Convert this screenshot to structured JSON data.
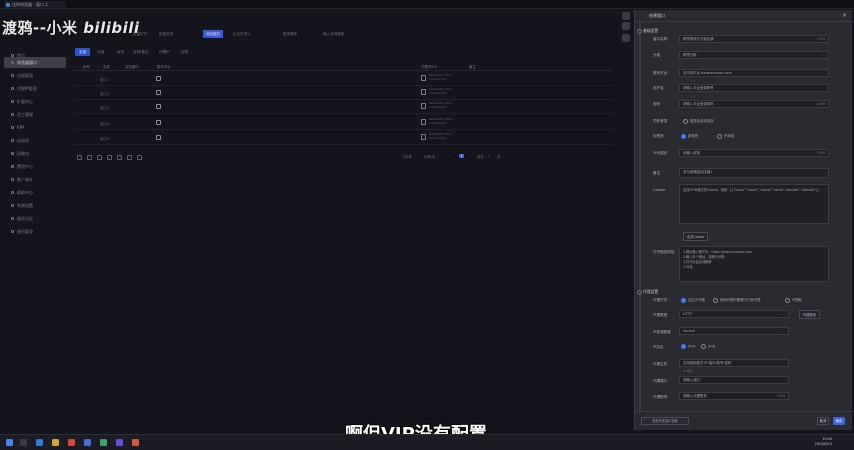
{
  "window": {
    "tab_title": "比特浏览器 - 窗口 1"
  },
  "watermark": {
    "text": "渡鸦--小米",
    "logo": "bilibili"
  },
  "toolbar": {
    "buttons": [
      "批量打开",
      "批量关闭",
      "添加窗口",
      "从文件导入",
      "更多操作",
      "输入名称搜索"
    ]
  },
  "filters": [
    "全部",
    "分组",
    "序号",
    "名称/备注",
    "代理IP",
    "标签"
  ],
  "table": {
    "headers": [
      "序号",
      "名称",
      "浏览器ID",
      "账号平台",
      "代理IP/UA",
      "备注"
    ],
    "rows": [
      {
        "name": "窗口1",
        "ua": "Mozilla/5.0 (Win...",
        "ua2": "Chrome/112"
      },
      {
        "name": "窗口2",
        "ua": "Mozilla/5.0 (Win...",
        "ua2": "Chrome/112"
      },
      {
        "name": "窗口3",
        "ua": "Mozilla/5.0 (Win...",
        "ua2": "Chrome/112"
      },
      {
        "name": "窗口4",
        "ua": "Mozilla/5.0 (Win...",
        "ua2": "Chrome/112"
      },
      {
        "name": "窗口5",
        "ua": "Mozilla/5.0 (Win...",
        "ua2": "Chrome/112"
      }
    ],
    "pager": {
      "total": "共5条",
      "page_size": "10条/页",
      "current": "1",
      "goto": "前往",
      "page": "1",
      "suffix": "页"
    }
  },
  "sidebar": {
    "items": [
      "首页",
      "浏览器窗口",
      "分组管理",
      "代理IP管理",
      "扩展中心",
      "员工管理",
      "RPA",
      "自动化",
      "回收站",
      "费用中心",
      "推广有礼",
      "帮助中心",
      "系统设置",
      "操作日志",
      "退出登录"
    ]
  },
  "drawer": {
    "title": "创建窗口",
    "close": "×",
    "section_basic": "基础设置",
    "section_proxy": "代理设置",
    "fields": {
      "window_name": {
        "label": "窗口名称",
        "value": "跨境电商亚马逊店铺",
        "count": "0/50"
      },
      "group": {
        "label": "分组",
        "value": "跨境分组"
      },
      "platform": {
        "label": "账号平台",
        "value": "亚马逊平台 www.amazon.com",
        "extra": "自定义平台"
      },
      "username": {
        "label": "用户名",
        "value": "请输入平台登录账号"
      },
      "password": {
        "label": "密码",
        "value": "请输入平台登录密码",
        "count": "0/50"
      },
      "sync": {
        "label": "同步登录",
        "value": "登录后自动保存"
      },
      "tab_mode": {
        "label": "标签页",
        "opt1": "新标签",
        "opt2": "不添加"
      },
      "twofa": {
        "label": "2FA密钥",
        "value": "请输入密钥",
        "count": "0/50"
      },
      "remark": {
        "label": "备注",
        "value": "亚马逊美国站店铺1"
      },
      "cookie": {
        "label": "Cookie",
        "value": "支持JSON格式的Cookie，例如：[{\"name\":\"name\",\"value\":\"value\",\"domain\":\"domain\"}]"
      },
      "cookie_btn": "合并Cookie",
      "open_urls": {
        "label": "打开指定网址",
        "line1": "1.网址输入格式为：https://www.amazon.com",
        "line2": "2.输入多个网址，用换行分隔",
        "line3": "3.打开后会自动跳转",
        "line4": "4.可选"
      }
    },
    "proxy": {
      "mode": {
        "label": "代理方式",
        "opt1": "自定义代理",
        "opt2": "使用代理IP管理中已有代理",
        "opt3": "IP提取"
      },
      "type": {
        "label": "代理类型",
        "value": "HTTP",
        "btn": "代理检测"
      },
      "ip_query": {
        "label": "IP查询渠道",
        "value": "Socks5"
      },
      "ipv": {
        "label": "IP协议",
        "opt1": "IPv4",
        "opt2": "IPv6"
      },
      "host": {
        "label": "代理主机",
        "value": "支持粘贴格式 IP:端口:账号:密码",
        "hint": "IP:端口"
      },
      "port": {
        "label": "代理端口",
        "value": "请输入端口"
      },
      "account": {
        "label": "代理账号",
        "value": "请输入代理账号",
        "count": "0/50"
      }
    },
    "footer": {
      "left": "查看历史窗口设置",
      "cancel": "取消",
      "ok": "确定"
    }
  },
  "subtitle": "啊但VIP没有配置",
  "taskbar": {
    "time": "15:40",
    "date": "2023/6/13"
  },
  "colors": {
    "accent": "#3b63e3",
    "bg": "#14151c",
    "drawer": "#2a2b31"
  }
}
